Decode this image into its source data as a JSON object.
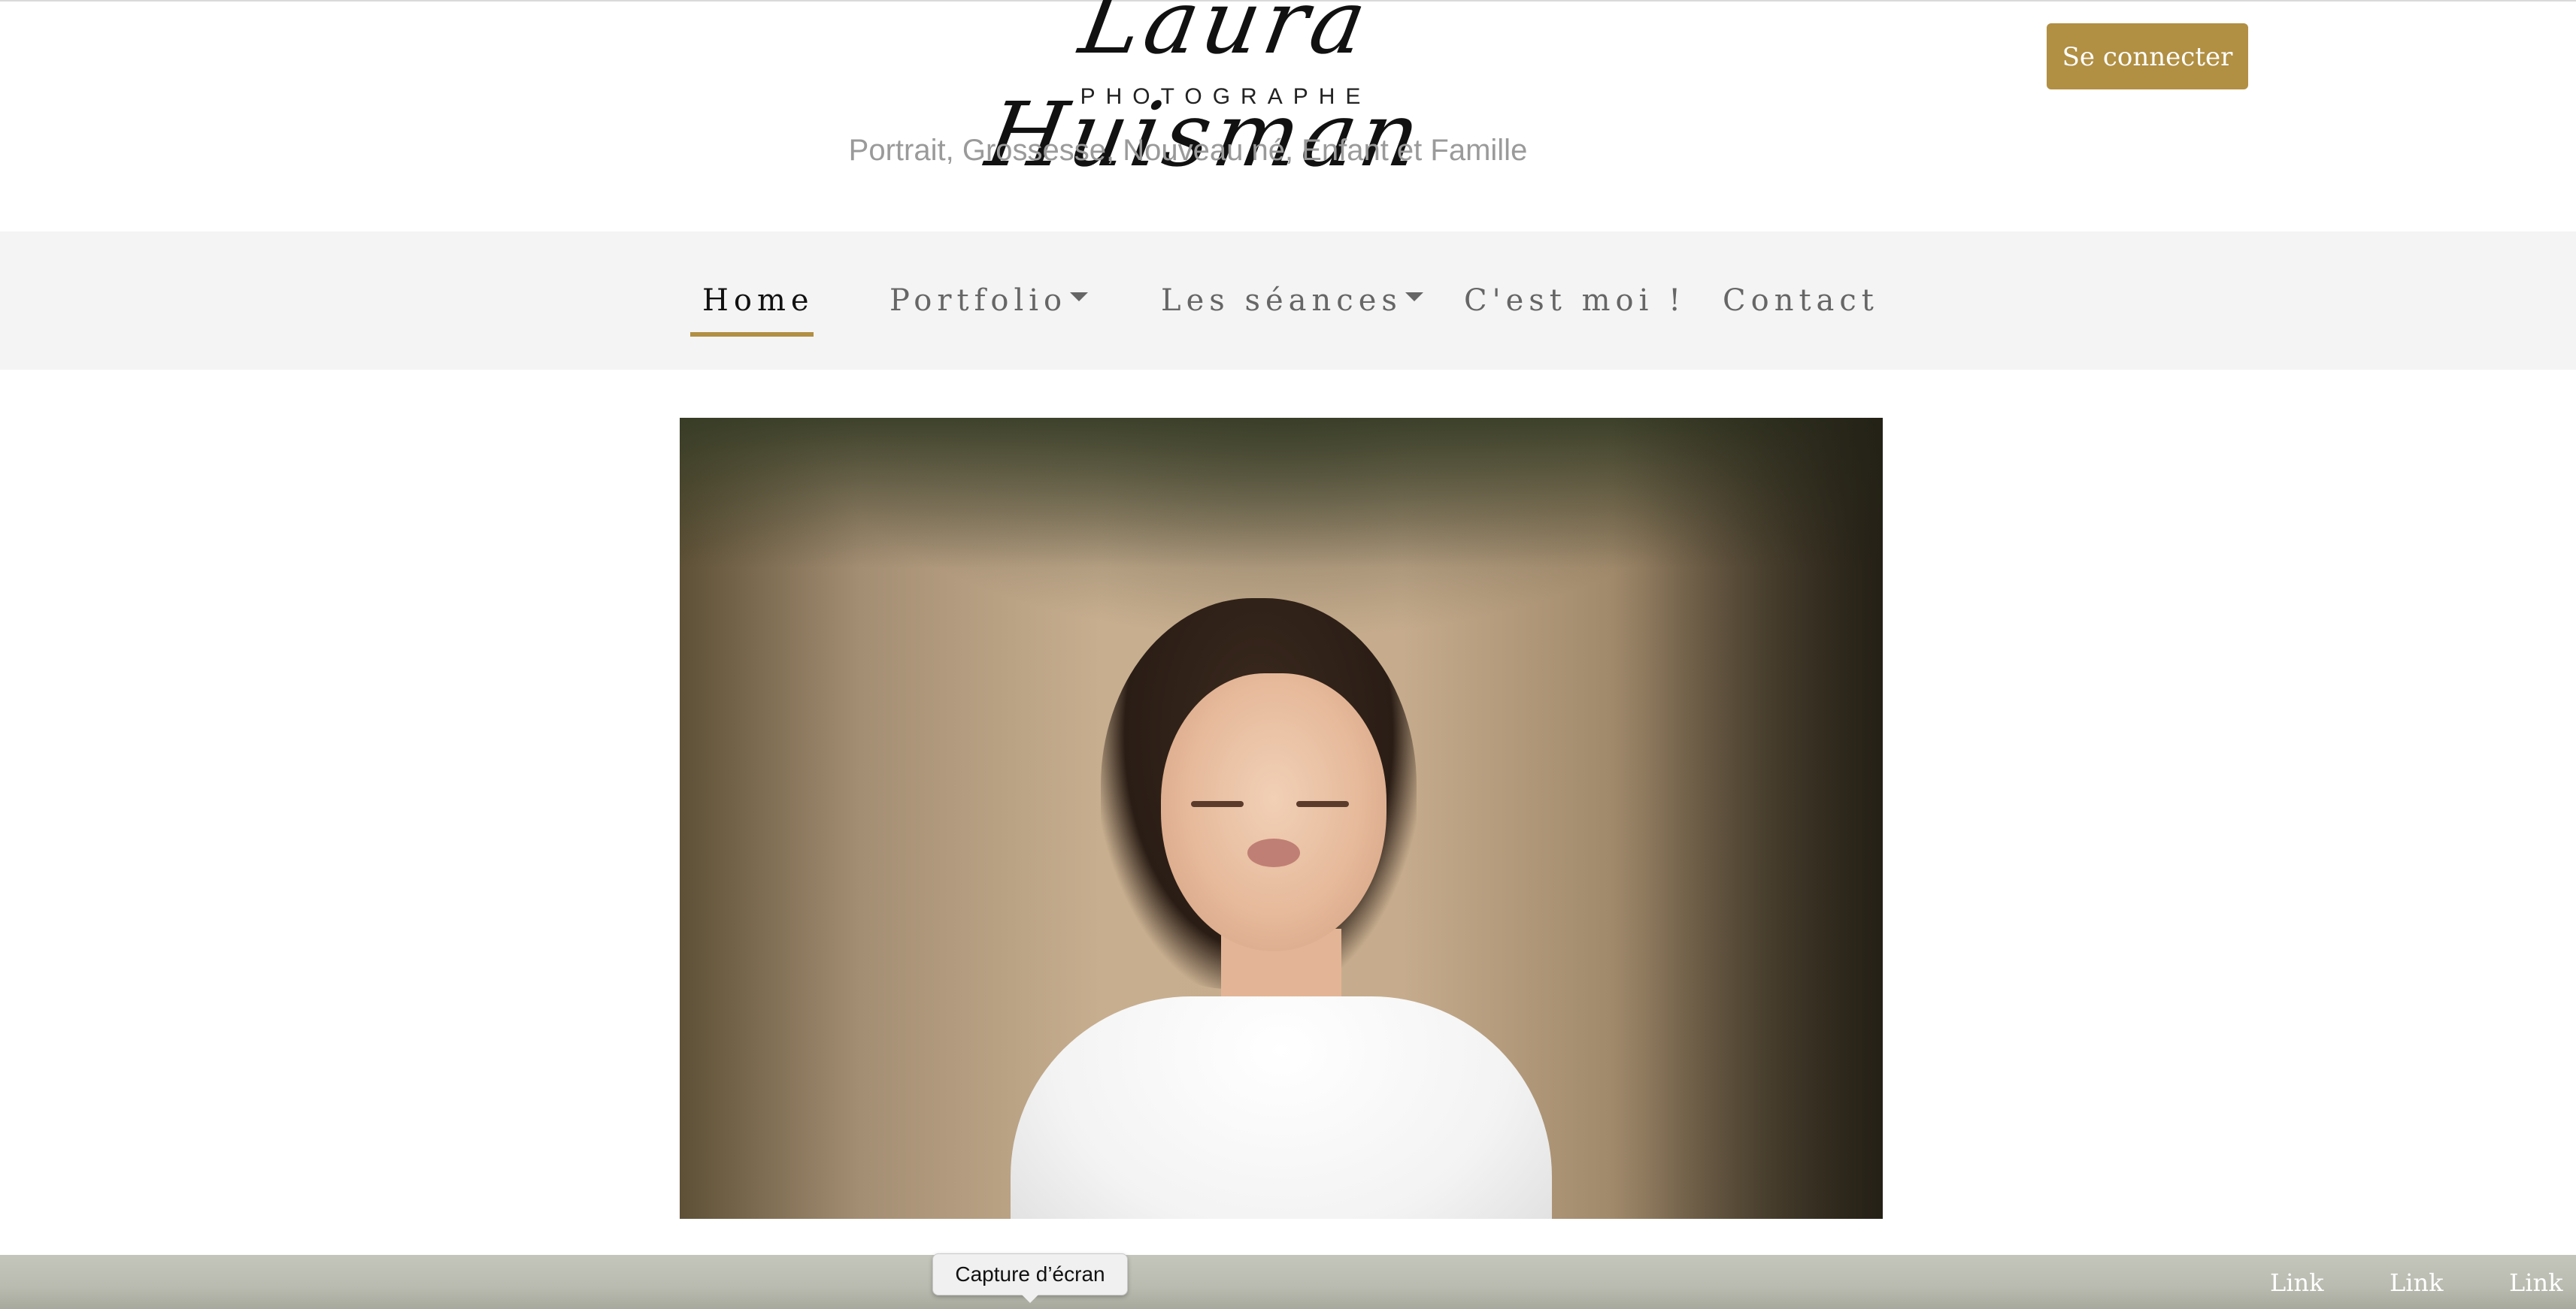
{
  "header": {
    "logo_name": "Laura Huisman",
    "logo_subtitle": "PHOTOGRAPHE",
    "tagline": "Portrait, Grossesse, Nouveau né, Enfant et Famille",
    "login_label": "Se connecter"
  },
  "nav": {
    "items": [
      {
        "label": "Home",
        "active": true
      },
      {
        "label": "Portfolio",
        "dropdown": true
      },
      {
        "label": "Les séances",
        "dropdown": true
      },
      {
        "label": "C'est moi !"
      },
      {
        "label": "Contact"
      }
    ]
  },
  "hero": {
    "icon": "photo-child-portrait"
  },
  "footer": {
    "links": [
      "Link",
      "Link",
      "Link"
    ]
  },
  "tooltip": {
    "text": "Capture d’écran"
  },
  "colors": {
    "accent": "#b18f43",
    "navbar_bg": "#f4f4f4",
    "nav_text": "#666666",
    "tagline": "#9a9a9a"
  }
}
